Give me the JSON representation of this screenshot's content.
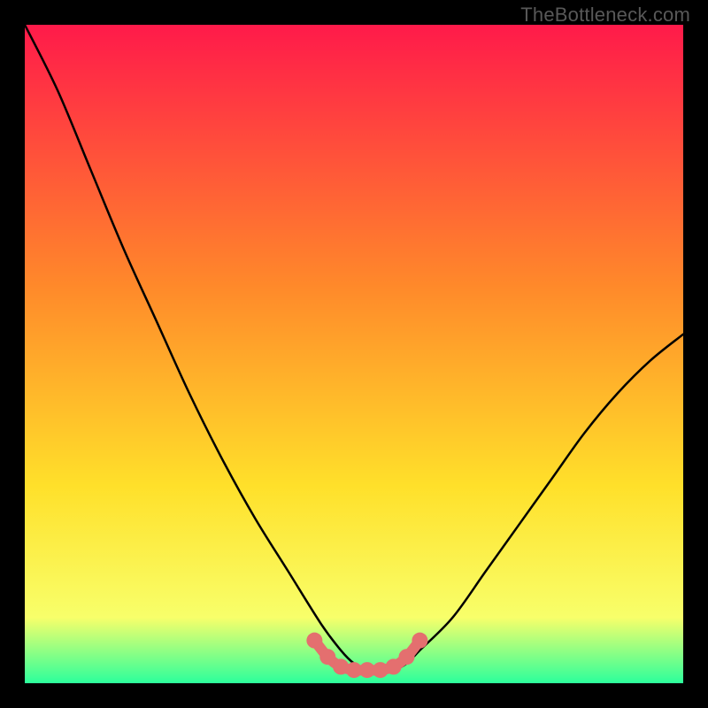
{
  "watermark": "TheBottleneck.com",
  "colors": {
    "bg": "#000000",
    "gradient_top": "#ff1a4a",
    "gradient_mid1": "#ff8a2a",
    "gradient_mid2": "#ffe02a",
    "gradient_mid3": "#f8ff6a",
    "gradient_bot": "#2cff9c",
    "curve": "#000000",
    "marker": "#e46f6f"
  },
  "chart_data": {
    "type": "line",
    "title": "",
    "xlabel": "",
    "ylabel": "",
    "xlim": [
      0,
      100
    ],
    "ylim": [
      0,
      100
    ],
    "series": [
      {
        "name": "bottleneck-curve",
        "x": [
          0,
          5,
          10,
          15,
          20,
          25,
          30,
          35,
          40,
          45,
          48,
          50,
          52,
          54,
          56,
          58,
          60,
          65,
          70,
          75,
          80,
          85,
          90,
          95,
          100
        ],
        "y": [
          100,
          90,
          78,
          66,
          55,
          44,
          34,
          25,
          17,
          9,
          5,
          3,
          2,
          2,
          2,
          3,
          5,
          10,
          17,
          24,
          31,
          38,
          44,
          49,
          53
        ]
      }
    ],
    "markers": {
      "name": "highlight-band",
      "x": [
        44,
        46,
        48,
        50,
        52,
        54,
        56,
        58,
        60
      ],
      "y": [
        6.5,
        4.0,
        2.5,
        2.0,
        2.0,
        2.0,
        2.5,
        4.0,
        6.5
      ]
    }
  }
}
